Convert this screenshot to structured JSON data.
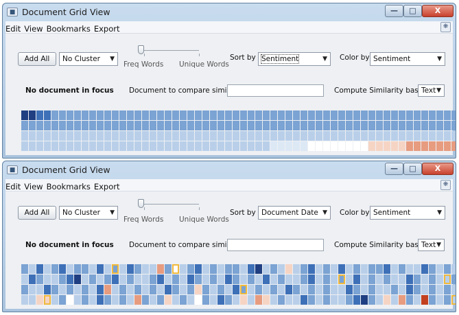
{
  "windows": [
    {
      "title": "Document Grid View",
      "menu": [
        "Edit",
        "View",
        "Bookmarks",
        "Export"
      ],
      "add_all": "Add All",
      "cluster": "No Cluster",
      "freq_words": "Freq Words",
      "unique_words": "Unique Words",
      "sort_by_label": "Sort by",
      "sort_by_value": "Sentiment",
      "color_by_label": "Color by",
      "color_by_value": "Sentiment",
      "focus_text": "No document in focus",
      "compare_label": "Document to compare similarity to",
      "compare_value": "",
      "compute_label": "Compute Similarity based on",
      "compute_value": "Text",
      "grid_rows": [
        "DDMMLLLLLLLLLLLLLLLLLLLLLLLLLLLLLLLLLLLLLLLLLLLLLLLLLLLLLLLL",
        "LLLLLLLLLLLLLLLLLLLLLLLLLLLLLLLLLLLLLLLLLLLLLLLLLLLLLLLLLLLL",
        "PPPPPPPPPPPPPPPPPPPPPPPPPPPPPPPPPPPPPPPPPPPPPPPPPPPPPPPPPPPP",
        "PPPPPPPPPPPPPPPPPPPPPPPPPPPPPPPPPVVVVVWWWWWWWWCCCCCRRRRRRRKDD"
      ],
      "grid_highlights": [
        "....................................................................",
        "...........................................................O",
        "..........................................................O.",
        "..........................................................O."
      ]
    },
    {
      "title": "Document Grid View",
      "menu": [
        "Edit",
        "View",
        "Bookmarks",
        "Export"
      ],
      "add_all": "Add All",
      "cluster": "No Cluster",
      "freq_words": "Freq Words",
      "unique_words": "Unique Words",
      "sort_by_label": "Sort by",
      "sort_by_value": "Document Date",
      "color_by_label": "Color by",
      "color_by_value": "Sentiment",
      "focus_text": "No document in focus",
      "compare_label": "Document to compare similarity to",
      "compare_value": "",
      "compute_label": "Compute Similarity based on",
      "compute_value": "Text",
      "grid_rows": [
        "LPMPLMPLLPMPLPMLPPRLWPLMPLPLLPMDPLPCPLMPLPMPLPLLMPLPPMLPLPLP",
        "PMLPPLMDPLPLMPLPPLMPLPMLPLPMLPLPMPLPPLMPLPLPMPLPLPPMLPLPPLMP",
        "LPPMLPLPLPMRPLPLPLPMLPLCLPLPMLPLPLPMLPLPLPPMLPLPPLPMLPLPLPMP",
        "PPCCPLWPLPMLPLPRLPLCPLPWLPMLPCPRCPLPPMLPLPPLMDLPCPRLPKLPLPKD"
      ],
      "grid_highlights": [
        "............O.......O...............................................",
        "..........................................O.............O.....O...",
        ".............................O.............................O.......",
        "...O.....................................................O......O.O"
      ]
    }
  ],
  "palette": {
    "D": "#1f3f82",
    "M": "#3e70b8",
    "L": "#7ba3d3",
    "P": "#b9cfe9",
    "V": "#dde8f5",
    "W": "#ffffff",
    "C": "#f6d4c4",
    "R": "#e79c80",
    "K": "#c2401f",
    "highlight": "#f0b93c"
  }
}
